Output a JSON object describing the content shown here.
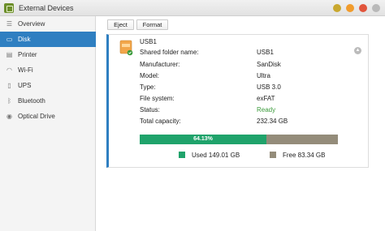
{
  "window": {
    "title": "External Devices",
    "controls": [
      {
        "name": "window-control-1",
        "color": "#c9a82f"
      },
      {
        "name": "window-control-2",
        "color": "#f19c2c"
      },
      {
        "name": "window-control-3",
        "color": "#e1543b"
      },
      {
        "name": "window-control-4",
        "color": "#b9b9b9"
      }
    ]
  },
  "sidebar": {
    "items": [
      {
        "label": "Overview",
        "icon": "list-icon",
        "active": false
      },
      {
        "label": "Disk",
        "icon": "disk-icon",
        "active": true
      },
      {
        "label": "Printer",
        "icon": "printer-icon",
        "active": false
      },
      {
        "label": "Wi-Fi",
        "icon": "wifi-icon",
        "active": false
      },
      {
        "label": "UPS",
        "icon": "ups-icon",
        "active": false
      },
      {
        "label": "Bluetooth",
        "icon": "bluetooth-icon",
        "active": false
      },
      {
        "label": "Optical Drive",
        "icon": "optical-drive-icon",
        "active": false
      }
    ]
  },
  "toolbar": {
    "eject_label": "Eject",
    "format_label": "Format"
  },
  "device": {
    "name": "USB1",
    "icon": "usb-drive-icon",
    "fields": [
      {
        "label": "Shared folder name:",
        "value": "USB1"
      },
      {
        "label": "Manufacturer:",
        "value": "SanDisk"
      },
      {
        "label": "Model:",
        "value": "Ultra"
      },
      {
        "label": "Type:",
        "value": "USB 3.0"
      },
      {
        "label": "File system:",
        "value": "exFAT"
      },
      {
        "label": "Status:",
        "value": "Ready"
      },
      {
        "label": "Total capacity:",
        "value": "232.34 GB"
      }
    ],
    "usage": {
      "used_fraction": 0.6413,
      "percent_label": "64.13%",
      "used_label": "Used 149.01 GB",
      "free_label": "Free 83.34 GB",
      "used_color": "#1fa36b",
      "free_color": "#948c7a"
    }
  },
  "colors": {
    "accent": "#2f7fc1",
    "status_ready": "#3c9b3c"
  }
}
